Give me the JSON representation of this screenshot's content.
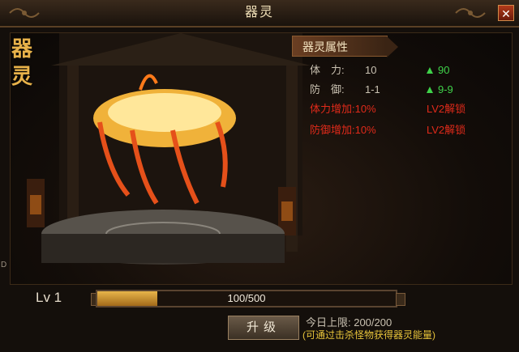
{
  "window": {
    "title": "器灵",
    "close_label": "✕"
  },
  "side_title": [
    "器",
    "灵"
  ],
  "panel": {
    "header": "器灵属性",
    "stats": [
      {
        "label": "体　力:",
        "value": "10",
        "upgrade": "90"
      },
      {
        "label": "防　御:",
        "value": "1-1",
        "upgrade": "9-9"
      }
    ],
    "bonuses": [
      {
        "label": "体力增加:",
        "value": "10%",
        "lock": "LV2解锁"
      },
      {
        "label": "防御增加:",
        "value": "10%",
        "lock": "LV2解锁"
      }
    ]
  },
  "level": {
    "label": "Lv 1"
  },
  "progress": {
    "text": "100/500",
    "current": 100,
    "max": 500
  },
  "upgrade_button": "升级",
  "daily_limit": "今日上限: 200/200",
  "hint": "(可通过击杀怪物获得器灵能量)",
  "edge_label": "D",
  "colors": {
    "accent_gold": "#e8b24a",
    "stat_red": "#e02a1a",
    "stat_green": "#3fd24a",
    "hint_yellow": "#e8c43a"
  }
}
